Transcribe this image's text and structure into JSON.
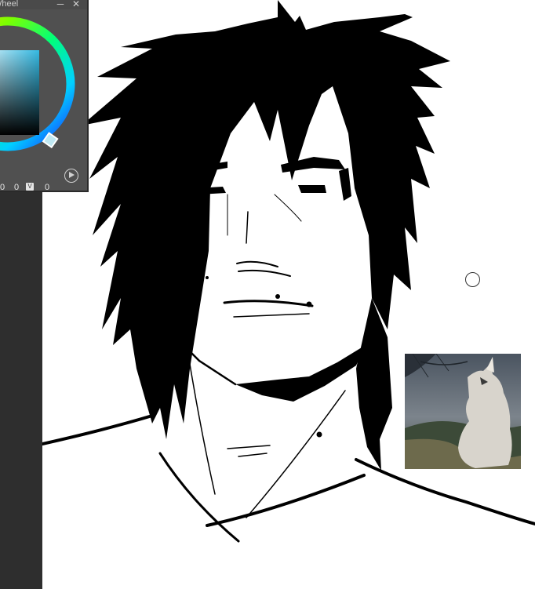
{
  "panel": {
    "title": "Wheel",
    "minimize_icon": "minimize-icon",
    "close_icon": "close-icon",
    "readout": {
      "h_value": "0",
      "s_value": "0",
      "v_label": "V",
      "v_value": "0"
    },
    "play_icon": "play-icon"
  },
  "colors": {
    "dock": "#2e2e2e",
    "panel_bg": "#3c3c3c",
    "canvas_bg": "#ffffff",
    "selected_hue": "#35b9e2"
  }
}
